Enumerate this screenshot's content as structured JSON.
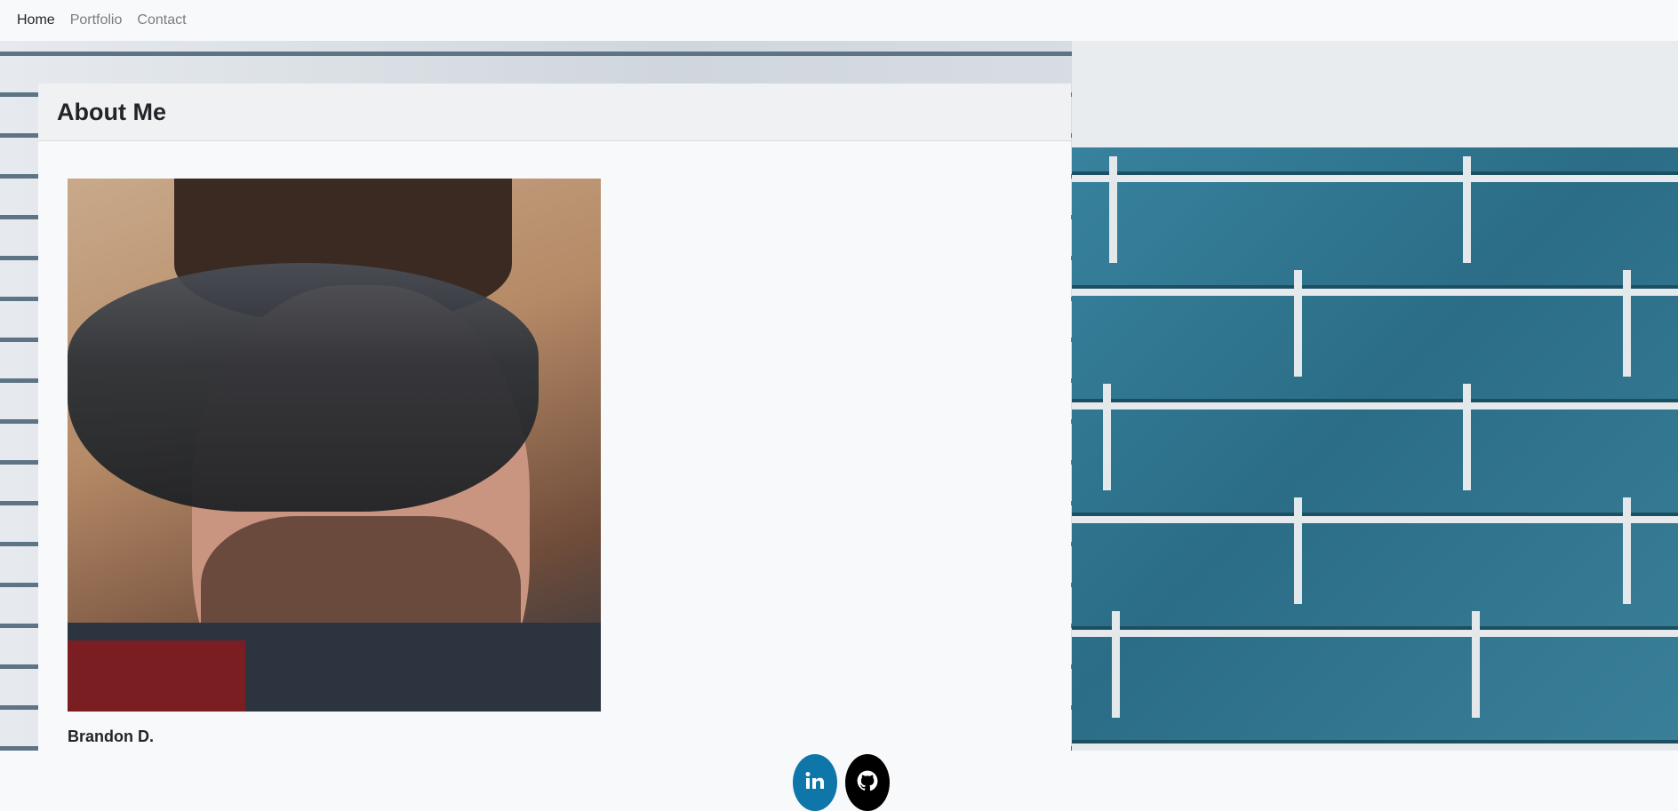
{
  "nav": {
    "items": [
      {
        "label": "Home",
        "active": true
      },
      {
        "label": "Portfolio",
        "active": false
      },
      {
        "label": "Contact",
        "active": false
      }
    ]
  },
  "about": {
    "title": "About Me",
    "name": "Brandon D.",
    "photo_alt": "Brandon D."
  },
  "social": {
    "linkedin_icon": "linkedin-icon",
    "github_icon": "github-icon",
    "linkedin_color": "#0e76a8",
    "github_color": "#000000"
  }
}
